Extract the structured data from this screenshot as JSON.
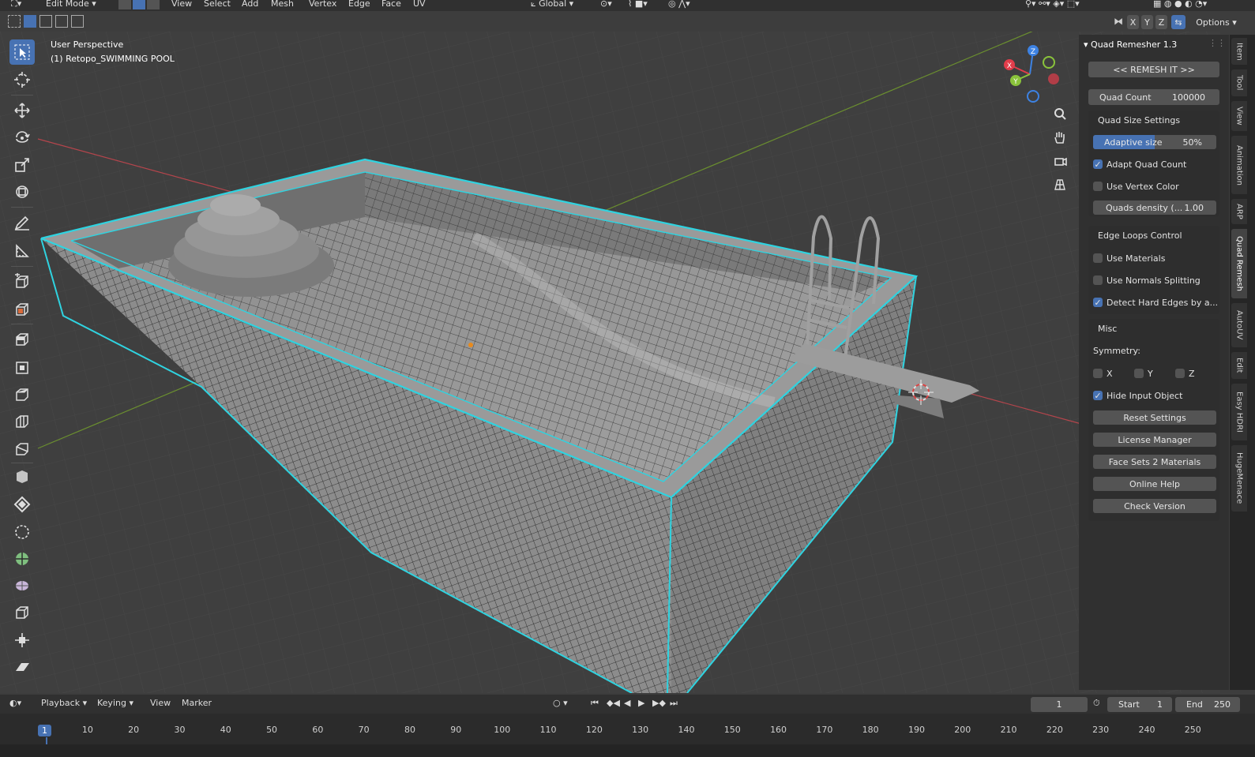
{
  "header": {
    "mode": "Edit Mode",
    "menus": [
      "View",
      "Select",
      "Add",
      "Mesh",
      "Vertex",
      "Edge",
      "Face",
      "UV"
    ],
    "orientation": "Global",
    "axes": [
      "X",
      "Y",
      "Z"
    ],
    "options": "Options"
  },
  "viewport": {
    "perspective": "User Perspective",
    "object": "(1) Retopo_SWIMMING POOL",
    "gizmo": {
      "x": "X",
      "y": "Y",
      "z": "Z"
    }
  },
  "panel": {
    "title": "Quad Remesher 1.3",
    "remesh_btn": "<< REMESH IT >>",
    "quad_count_label": "Quad Count",
    "quad_count_value": "100000",
    "quad_size_title": "Quad Size Settings",
    "adaptive_label": "Adaptive size",
    "adaptive_value": "50%",
    "adaptive_fraction": 0.5,
    "adapt_quad_count": "Adapt Quad Count",
    "use_vertex_color": "Use Vertex Color",
    "quads_density_label": "Quads density (...",
    "quads_density_value": "1.00",
    "edge_loops_title": "Edge Loops Control",
    "use_materials": "Use Materials",
    "use_normals": "Use Normals Splitting",
    "detect_hard": "Detect Hard Edges by a...",
    "misc_title": "Misc",
    "symmetry": "Symmetry:",
    "sym_x": "X",
    "sym_y": "Y",
    "sym_z": "Z",
    "hide_input": "Hide Input Object",
    "buttons": [
      "Reset Settings",
      "License Manager",
      "Face Sets 2 Materials",
      "Online Help",
      "Check Version"
    ]
  },
  "tabs": [
    "Item",
    "Tool",
    "View",
    "Animation",
    "ARP",
    "Quad Remesh",
    "AutoUV",
    "Edit",
    "Easy HDRI",
    "HugeMenace"
  ],
  "timeline": {
    "menus": [
      "Playback",
      "Keying",
      "View",
      "Marker"
    ],
    "current_frame": "1",
    "start_label": "Start",
    "start_value": "1",
    "end_label": "End",
    "end_value": "250",
    "ticks": [
      "1",
      "10",
      "20",
      "30",
      "40",
      "50",
      "60",
      "70",
      "80",
      "90",
      "100",
      "110",
      "120",
      "130",
      "140",
      "150",
      "160",
      "170",
      "180",
      "190",
      "200",
      "210",
      "220",
      "230",
      "240",
      "250"
    ]
  },
  "colors": {
    "accent": "#4772b3",
    "selection_edge": "#2fd3e0",
    "x_axis": "#e23d4b",
    "y_axis": "#8ac33b",
    "z_axis": "#3d82e2"
  }
}
